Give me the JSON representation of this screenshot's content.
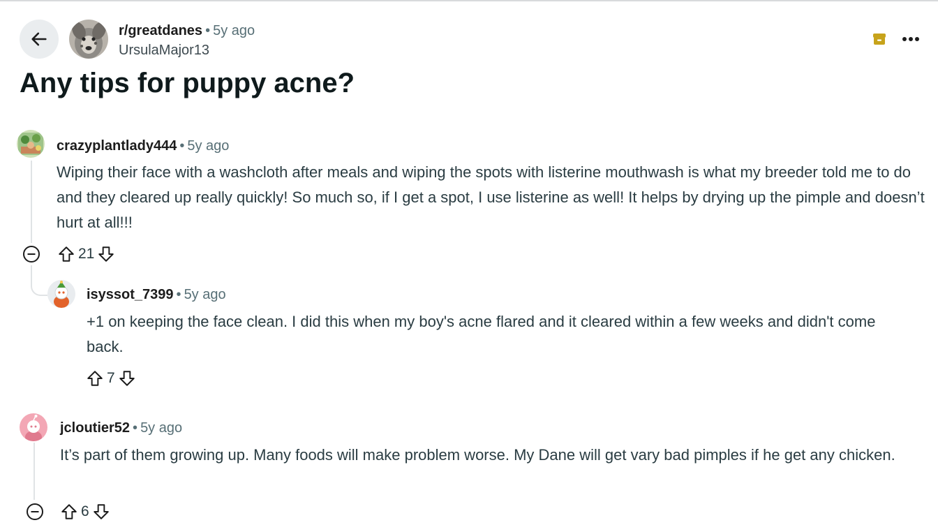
{
  "post": {
    "subreddit": "r/greatdanes",
    "separator": "•",
    "time": "5y ago",
    "author": "UrsulaMajor13",
    "title": "Any tips for puppy acne?"
  },
  "comments": [
    {
      "author": "crazyplantlady444",
      "time": "5y ago",
      "body": "Wiping their face with a washcloth after meals and wiping the spots with listerine mouthwash is what my breeder told me to do and they cleared up really quickly! So much so, if I get a spot, I use listerine as well! It helps by drying up the pimple and doesn’t hurt at all!!!",
      "score": "21"
    },
    {
      "author": "isyssot_7399",
      "time": "5y ago",
      "body": "+1 on keeping the face clean. I did this when my boy's acne flared and it cleared within a few weeks and didn't come back.",
      "score": "7"
    },
    {
      "author": "jcloutier52",
      "time": "5y ago",
      "body": "It’s part of them growing up. Many foods will make problem worse. My Dane will get vary bad pimples if he get any chicken.",
      "score": "6"
    }
  ],
  "icons": {
    "back": "arrow-left-icon",
    "archive": "archive-icon",
    "more": "more-horizontal-icon",
    "upvote": "arrow-up-outline-icon",
    "downvote": "arrow-down-outline-icon",
    "collapse": "minus-circle-icon"
  },
  "colors": {
    "archive": "#c7a31b",
    "meta": "#576f76",
    "button_bg": "#eaedef"
  }
}
